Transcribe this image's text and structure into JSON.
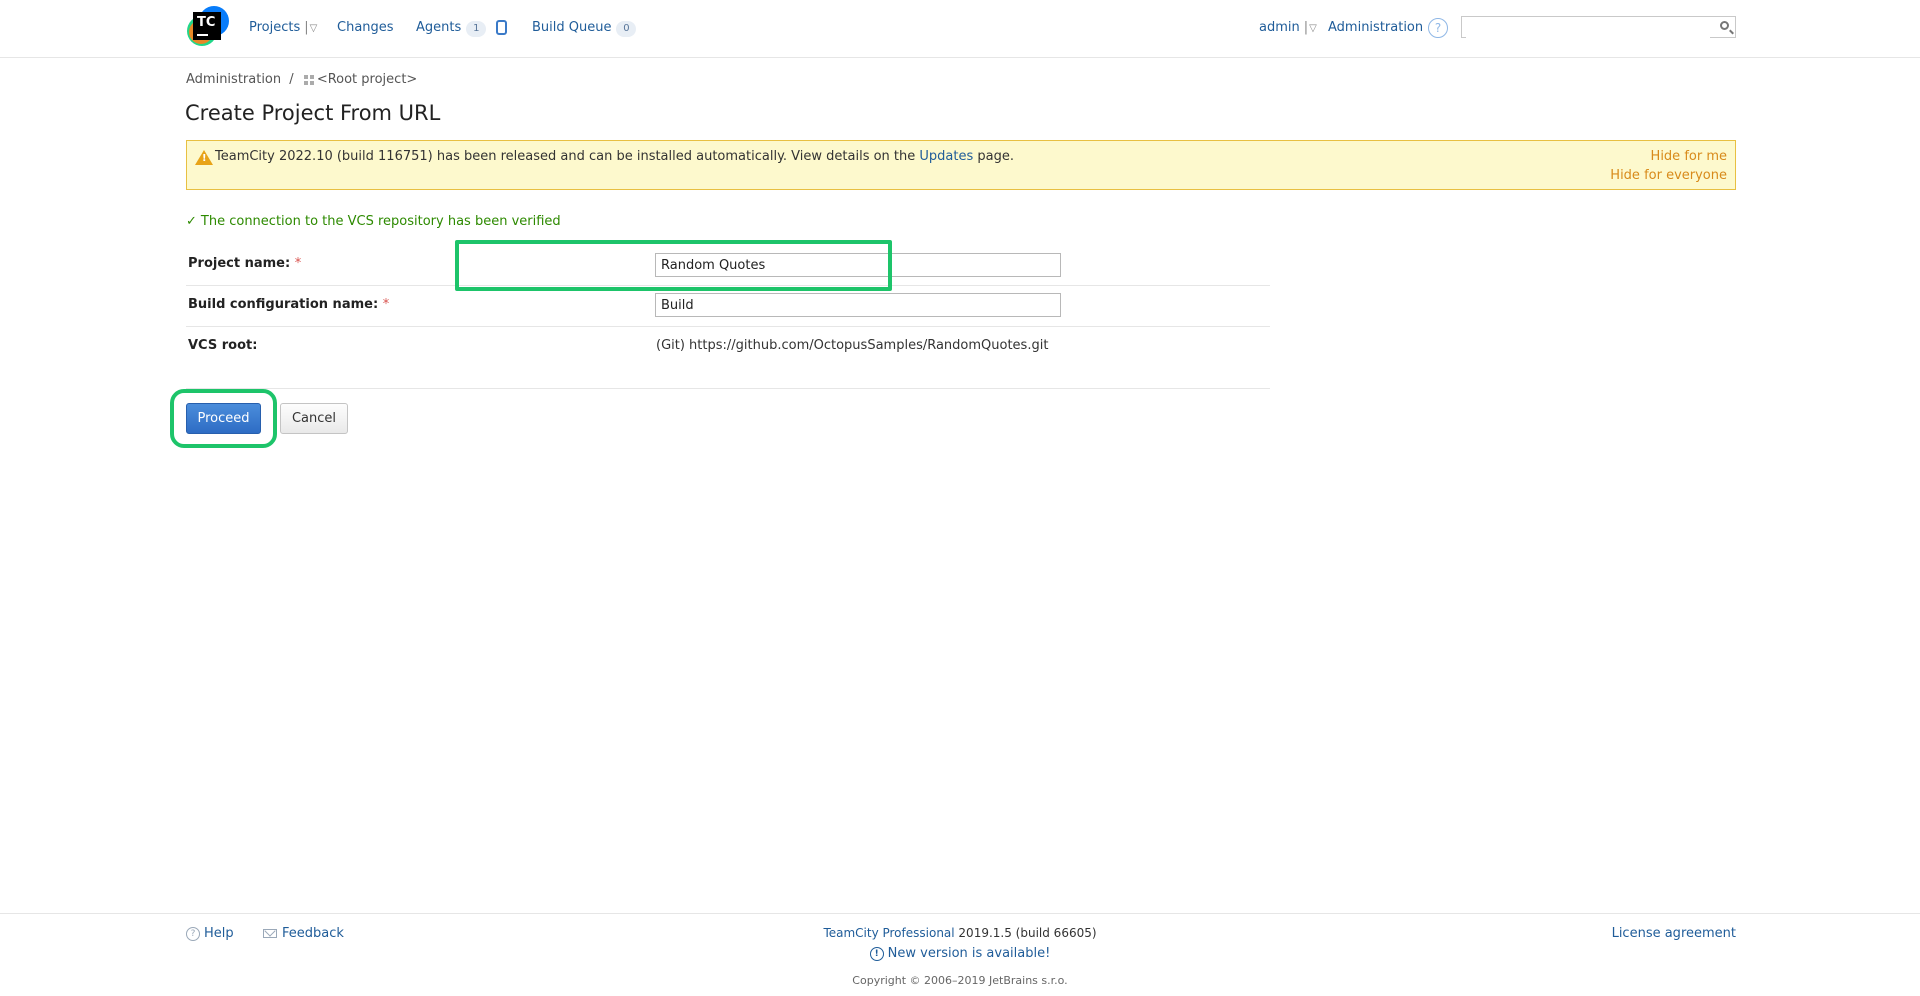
{
  "header": {
    "logo_text": "TC",
    "nav": {
      "projects": "Projects",
      "changes": "Changes",
      "agents": "Agents",
      "agents_count": "1",
      "build_queue": "Build Queue",
      "build_queue_count": "0"
    },
    "user": "admin",
    "administration": "Administration",
    "help_symbol": "?",
    "search_placeholder": ""
  },
  "breadcrumb": {
    "parent": "Administration",
    "separator": "/",
    "current": "<Root project>"
  },
  "page_title": "Create Project From URL",
  "banner": {
    "message_prefix": "TeamCity 2022.10 (build 116751) has been released and can be installed automatically. View details on the ",
    "link": "Updates",
    "message_suffix": " page.",
    "hide_for_me": "Hide for me",
    "hide_for_everyone": "Hide for everyone"
  },
  "verified": {
    "check": "✓",
    "text": "The connection to the VCS repository has been verified"
  },
  "form": {
    "project_name_label": "Project name:",
    "project_name_value": "Random Quotes",
    "build_config_label": "Build configuration name:",
    "build_config_value": "Build",
    "required_mark": "*",
    "vcs_root_label": "VCS root:",
    "vcs_root_value": "(Git) https://github.com/OctopusSamples/RandomQuotes.git"
  },
  "buttons": {
    "proceed": "Proceed",
    "cancel": "Cancel"
  },
  "footer": {
    "help": "Help",
    "feedback": "Feedback",
    "product_link": "TeamCity Professional",
    "product_version": " 2019.1.5 (build 66605)",
    "new_version": "New version is available!",
    "copyright": "Copyright © 2006–2019 JetBrains s.r.o.",
    "license": "License agreement"
  },
  "colors": {
    "link": "#1f5c99",
    "highlight": "#1dc46a",
    "banner_bg": "#fdf9cd",
    "banner_border": "#e8c042",
    "verified": "#2d8a00",
    "primary_button": "#2e6cc4"
  }
}
